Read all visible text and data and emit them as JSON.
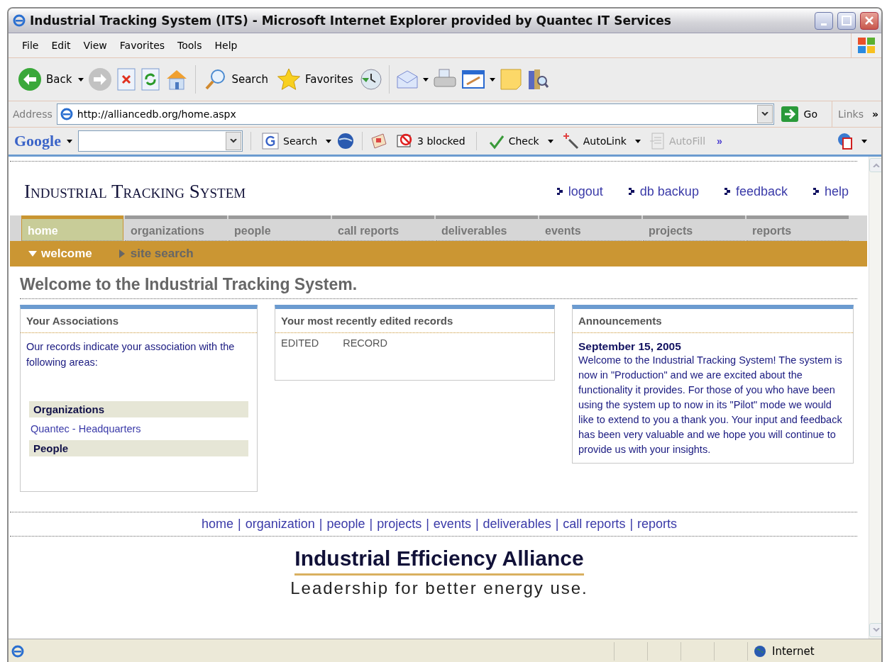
{
  "window": {
    "title": "Industrial Tracking System (ITS) - Microsoft Internet Explorer provided by Quantec IT Services"
  },
  "menu_bar": [
    "File",
    "Edit",
    "View",
    "Favorites",
    "Tools",
    "Help"
  ],
  "toolbar": {
    "back_label": "Back",
    "search_label": "Search",
    "favorites_label": "Favorites"
  },
  "address_bar": {
    "label": "Address",
    "value": "http://alliancedb.org/home.aspx",
    "go_label": "Go",
    "links_label": "Links",
    "more": "»"
  },
  "google_bar": {
    "logo": "Google",
    "search_label": "Search",
    "blocked_label": "3 blocked",
    "check_label": "Check",
    "autolink_label": "AutoLink",
    "autofill_label": "AutoFill",
    "autofill_disabled": true,
    "more": "»"
  },
  "page": {
    "site_title": "Industrial Tracking System",
    "top_links": [
      "logout",
      "db backup",
      "feedback",
      "help"
    ],
    "tabs": [
      {
        "label": "home",
        "selected": true
      },
      {
        "label": "organizations",
        "selected": false
      },
      {
        "label": "people",
        "selected": false
      },
      {
        "label": "call reports",
        "selected": false
      },
      {
        "label": "deliverables",
        "selected": false
      },
      {
        "label": "events",
        "selected": false
      },
      {
        "label": "projects",
        "selected": false
      },
      {
        "label": "reports",
        "selected": false
      }
    ],
    "subnav": [
      {
        "label": "welcome",
        "selected": true
      },
      {
        "label": "site search",
        "selected": false
      }
    ],
    "heading": "Welcome to the Industrial Tracking System.",
    "associations": {
      "title": "Your Associations",
      "intro": "Our records indicate your association with the following areas:",
      "groups": [
        {
          "title": "Organizations",
          "items": [
            "Quantec - Headquarters"
          ]
        },
        {
          "title": "People"
        }
      ]
    },
    "recent": {
      "title": "Your most recently edited records",
      "columns": [
        "EDITED",
        "RECORD"
      ]
    },
    "announcements": {
      "title": "Announcements",
      "date": "September 15, 2005",
      "body": "Welcome to the Industrial Tracking System! The system is now in \"Production\" and we are excited about the functionality it provides. For those of you who have been using the system up to now in its \"Pilot\" mode we would like to extend to you a thank you. Your input and feedback has been very valuable and we hope you will continue to provide us with your insights."
    },
    "footer_separator": "|",
    "footer_links": [
      "home",
      "organization",
      "people",
      "projects",
      "events",
      "deliverables",
      "call reports",
      "reports"
    ],
    "logo": {
      "name": "Industrial Efficiency Alliance",
      "tagline": "Leadership for better energy use."
    }
  },
  "status_bar": {
    "zone": "Internet"
  }
}
